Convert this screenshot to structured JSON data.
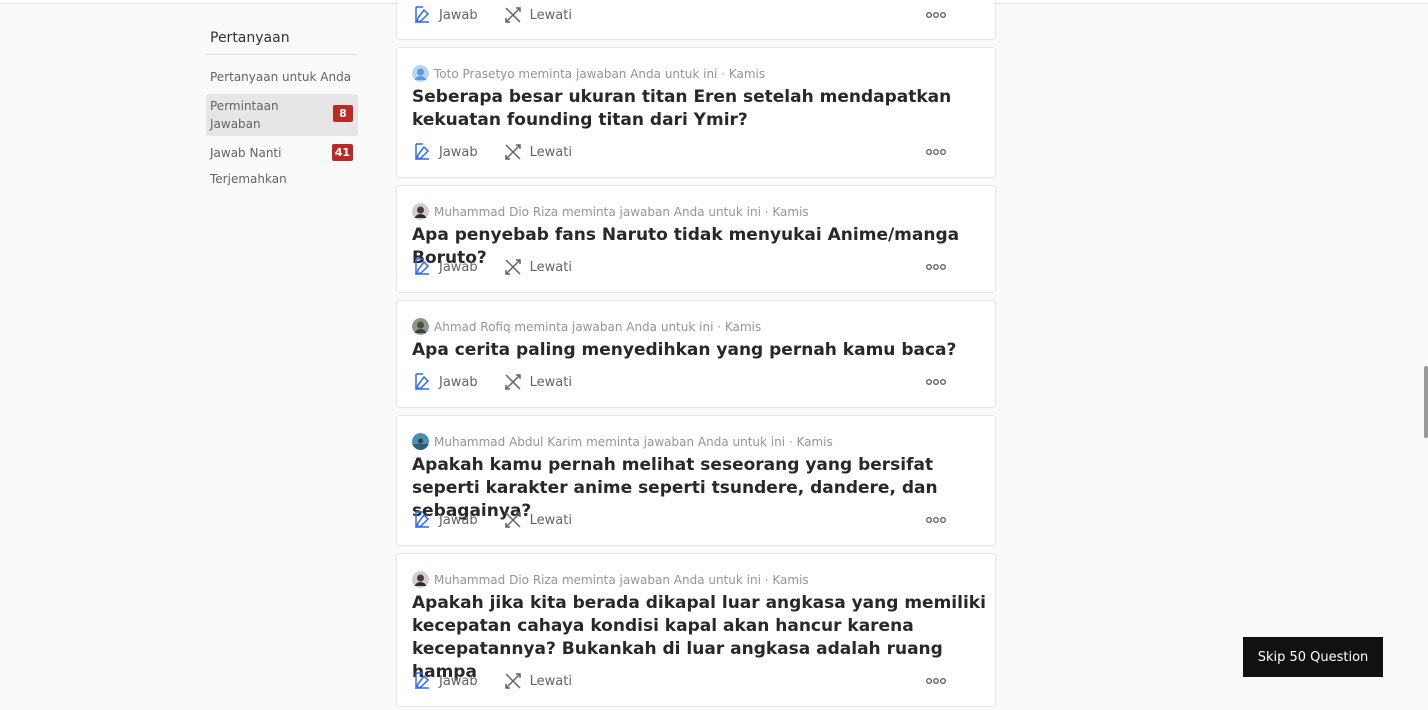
{
  "sidebar": {
    "title": "Pertanyaan",
    "items": [
      {
        "label": "Pertanyaan untuk Anda",
        "badge": ""
      },
      {
        "label": "Permintaan Jawaban",
        "badge": "8"
      },
      {
        "label": "Jawab Nanti",
        "badge": "41"
      },
      {
        "label": "Terjemahkan",
        "badge": ""
      }
    ]
  },
  "actions": {
    "answer": "Jawab",
    "skip": "Lewati"
  },
  "questions": [
    {
      "requester": "Toto Prasetyo meminta jawaban Anda untuk ini · Kamis",
      "text": "Seberapa besar ukuran titan Eren setelah mendapatkan kekuatan founding titan dari Ymir?"
    },
    {
      "requester": "Muhammad Dio Riza meminta jawaban Anda untuk ini · Kamis",
      "text": "Apa penyebab fans Naruto tidak menyukai Anime/manga Boruto?"
    },
    {
      "requester": "Ahmad Rofiq meminta jawaban Anda untuk ini · Kamis",
      "text": "Apa cerita paling menyedihkan yang pernah kamu baca?"
    },
    {
      "requester": "Muhammad Abdul Karim meminta jawaban Anda untuk ini · Kamis",
      "text": "Apakah kamu pernah melihat seseorang yang bersifat seperti karakter anime seperti tsundere, dandere, dan sebagainya?"
    },
    {
      "requester": "Muhammad Dio Riza meminta jawaban Anda untuk ini · Kamis",
      "text": "Apakah jika kita berada dikapal luar angkasa yang memiliki kecepatan cahaya kondisi kapal akan hancur karena kecepatannya? Bukankah di luar angkasa adalah ruang hampa"
    }
  ],
  "skip_button": "Skip 50 Question",
  "colors": {
    "accent": "#b92b27",
    "answer_icon": "#2e69ff",
    "button_bg": "#111111"
  }
}
